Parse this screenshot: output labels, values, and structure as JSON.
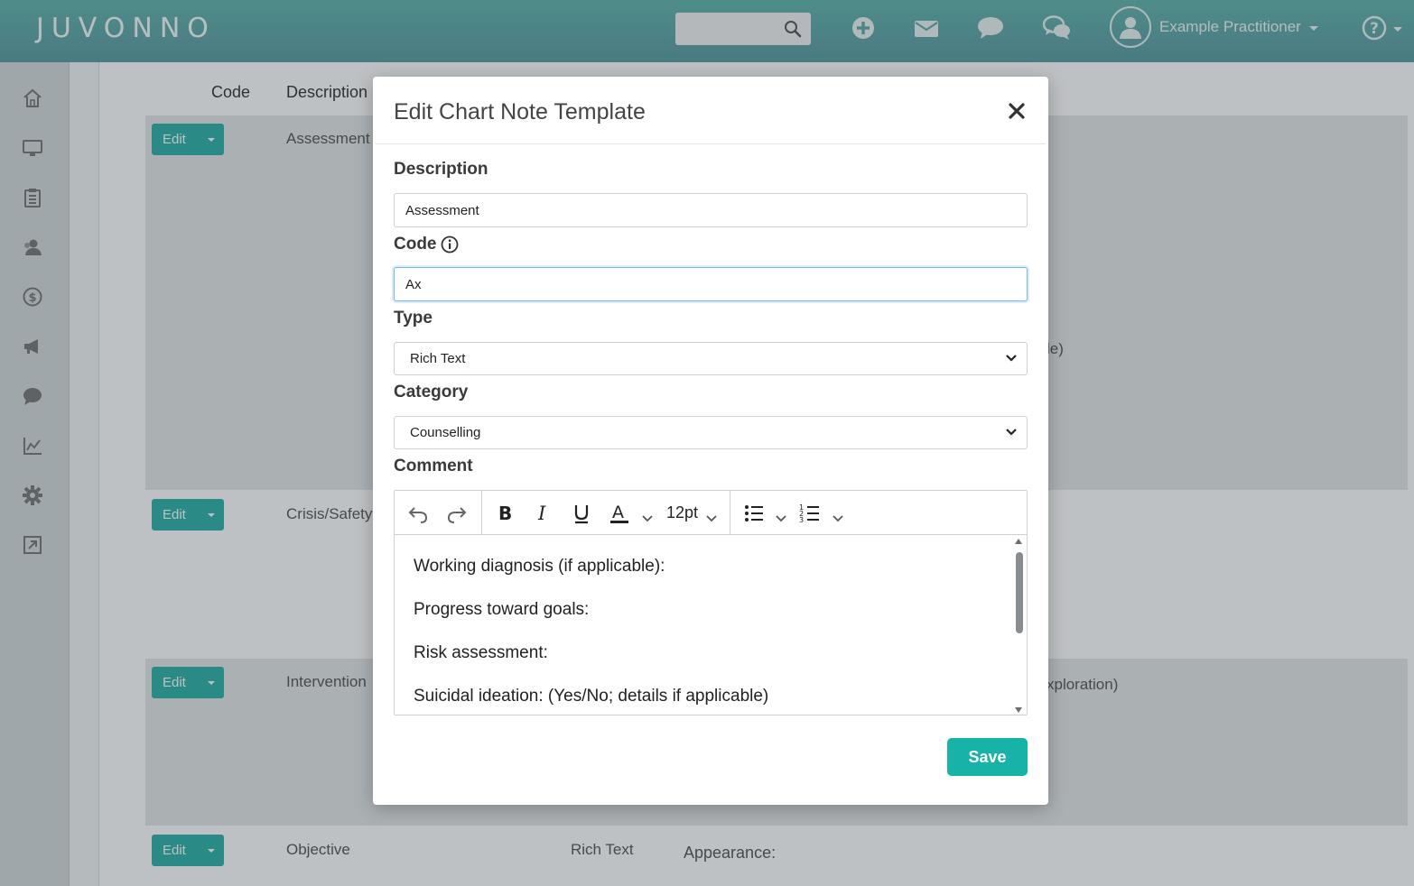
{
  "app": {
    "logo": "JUVONNO"
  },
  "topbar": {
    "user_name": "Example Practitioner",
    "icons": [
      "search-icon",
      "plus-circle-icon",
      "mail-icon",
      "chat-icon",
      "chat-bubbles-icon",
      "user-avatar-icon",
      "help-icon"
    ]
  },
  "sidebar": {
    "items": [
      "home-icon",
      "monitor-icon",
      "clipboard-icon",
      "clients-icon",
      "dollar-icon",
      "megaphone-icon",
      "chat-icon",
      "chart-icon",
      "gear-icon",
      "external-link-icon"
    ]
  },
  "table": {
    "headers": {
      "code": "Code",
      "description": "Description"
    },
    "edit_label": "Edit",
    "rows": [
      {
        "description": "Assessment",
        "type": "",
        "comment_tail": "le)"
      },
      {
        "description": "Crisis/Safety",
        "type": "",
        "comment_tail": ""
      },
      {
        "description": "Intervention",
        "type": "",
        "comment_tail": "xploration)"
      },
      {
        "description": "Objective",
        "type": "Rich Text",
        "comment_tail": "Appearance:"
      }
    ]
  },
  "modal": {
    "title": "Edit Chart Note Template",
    "description_label": "Description",
    "description_value": "Assessment",
    "code_label": "Code",
    "code_value": "Ax",
    "type_label": "Type",
    "type_value": "Rich Text",
    "category_label": "Category",
    "category_value": "Counselling",
    "comment_label": "Comment",
    "font_size": "12pt",
    "comment_lines": [
      "Working diagnosis (if applicable):",
      "Progress toward goals:",
      "Risk assessment:",
      "Suicidal ideation: (Yes/No; details if applicable)"
    ],
    "save_label": "Save"
  }
}
